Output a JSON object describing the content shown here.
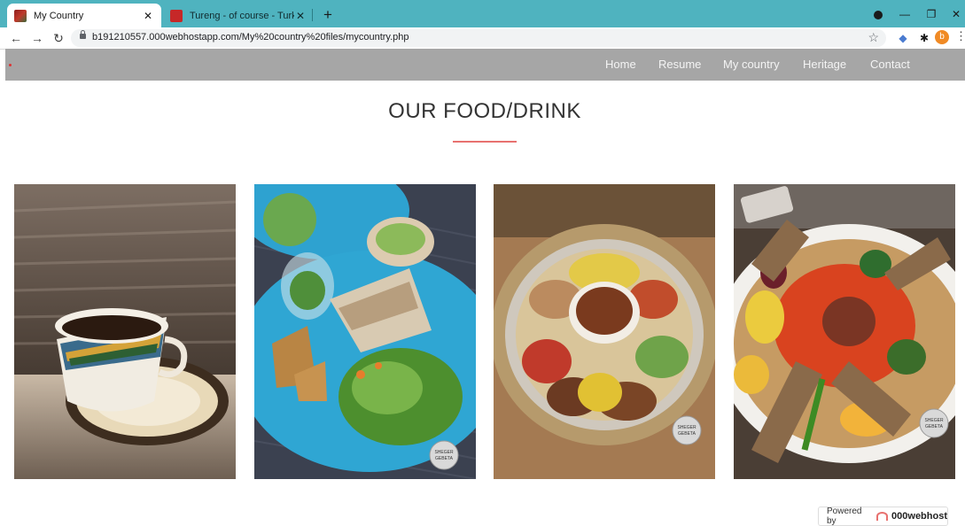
{
  "browser": {
    "tabs": [
      {
        "title": "My Country",
        "active": true
      },
      {
        "title": "Tureng - of course - Turkish Engl",
        "active": false
      }
    ],
    "new_tab_label": "+",
    "close_label": "✕",
    "url": "b191210557.000webhostapp.com/My%20country%20files/mycountry.php",
    "profile_initial": "b"
  },
  "site": {
    "nav": [
      "Home",
      "Resume",
      "My country",
      "Heritage",
      "Contact"
    ],
    "section_title": "OUR FOOD/DRINK",
    "accent_color": "#e8716f",
    "nav_bg_color": "#a6a6a6",
    "photo_watermark": [
      "SHEGER",
      "GEBETA"
    ],
    "photos": [
      {
        "subject": "coffee-cup"
      },
      {
        "subject": "wrap-plate"
      },
      {
        "subject": "injera-platter"
      },
      {
        "subject": "injera-feast"
      }
    ]
  },
  "footer": {
    "powered_by": "Powered by",
    "brand": "000webhost"
  }
}
